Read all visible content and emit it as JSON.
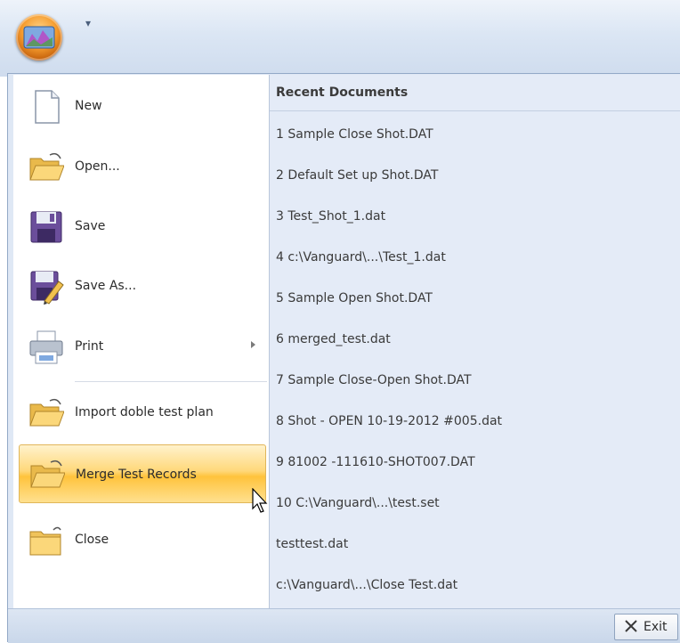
{
  "app": {
    "orb_icon": "application-orb-icon",
    "quick_access": "▾"
  },
  "menu": {
    "items": [
      {
        "label": "New",
        "icon": "new-document-icon"
      },
      {
        "label": "Open...",
        "icon": "open-folder-icon"
      },
      {
        "label": "Save",
        "icon": "save-disk-icon"
      },
      {
        "label": "Save As...",
        "icon": "save-as-icon"
      },
      {
        "label": "Print",
        "icon": "printer-icon"
      },
      {
        "label": "Import doble test plan",
        "icon": "import-folder-icon"
      },
      {
        "label": "Merge Test Records",
        "icon": "merge-folder-icon"
      },
      {
        "label": "Close",
        "icon": "close-folder-icon"
      }
    ],
    "highlighted_item": "Merge Test Records"
  },
  "recent": {
    "title": "Recent Documents",
    "items": [
      "1 Sample Close Shot.DAT",
      "2 Default Set up Shot.DAT",
      "3 Test_Shot_1.dat",
      "4 c:\\Vanguard\\...\\Test_1.dat",
      "5 Sample Open Shot.DAT",
      "6 merged_test.dat",
      "7 Sample Close-Open Shot.DAT",
      "8 Shot - OPEN 10-19-2012 #005.dat",
      "9 81002  -111610-SHOT007.DAT",
      "10 C:\\Vanguard\\...\\test.set",
      "testtest.dat",
      "c:\\Vanguard\\...\\Close Test.dat"
    ]
  },
  "footer": {
    "exit_label": "Exit"
  },
  "colors": {
    "highlight": "#ffc33c",
    "pane_blue": "#e4ebf7",
    "orb_orange": "#f59c2e"
  }
}
